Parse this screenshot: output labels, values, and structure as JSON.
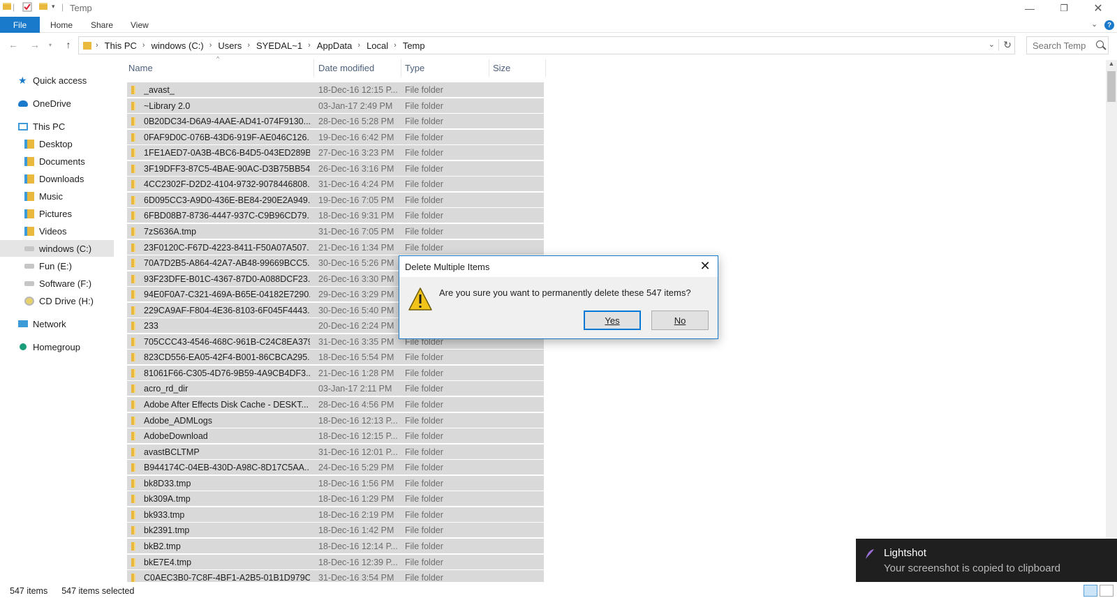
{
  "window": {
    "title": "Temp"
  },
  "ribbon": {
    "file_label": "File",
    "tabs": [
      {
        "label": "Home"
      },
      {
        "label": "Share"
      },
      {
        "label": "View"
      }
    ],
    "help_label": "?"
  },
  "address": {
    "crumbs": [
      "This PC",
      "windows (C:)",
      "Users",
      "SYEDAL~1",
      "AppData",
      "Local",
      "Temp"
    ]
  },
  "search": {
    "placeholder": "Search Temp"
  },
  "sidebar": {
    "items": [
      {
        "label": "Quick access",
        "icon": "star-icon"
      },
      {
        "label": "OneDrive",
        "icon": "cloud-icon"
      },
      {
        "label": "This PC",
        "icon": "computer-icon"
      },
      {
        "label": "Desktop",
        "icon": "desktop-folder-icon"
      },
      {
        "label": "Documents",
        "icon": "documents-folder-icon"
      },
      {
        "label": "Downloads",
        "icon": "downloads-folder-icon"
      },
      {
        "label": "Music",
        "icon": "music-folder-icon"
      },
      {
        "label": "Pictures",
        "icon": "pictures-folder-icon"
      },
      {
        "label": "Videos",
        "icon": "videos-folder-icon"
      },
      {
        "label": "windows (C:)",
        "icon": "windows-drive-icon",
        "selected": true
      },
      {
        "label": "Fun (E:)",
        "icon": "drive-icon"
      },
      {
        "label": "Software (F:)",
        "icon": "drive-icon"
      },
      {
        "label": "CD Drive (H:)",
        "icon": "cd-drive-icon"
      },
      {
        "label": "Network",
        "icon": "network-icon"
      },
      {
        "label": "Homegroup",
        "icon": "homegroup-icon"
      }
    ]
  },
  "columns": {
    "name": "Name",
    "date": "Date modified",
    "type": "Type",
    "size": "Size"
  },
  "files": [
    {
      "name": "_avast_",
      "date": "18-Dec-16 12:15 P...",
      "type": "File folder"
    },
    {
      "name": "~Library 2.0",
      "date": "03-Jan-17 2:49 PM",
      "type": "File folder"
    },
    {
      "name": "0B20DC34-D6A9-4AAE-AD41-074F9130...",
      "date": "28-Dec-16 5:28 PM",
      "type": "File folder"
    },
    {
      "name": "0FAF9D0C-076B-43D6-919F-AE046C126...",
      "date": "19-Dec-16 6:42 PM",
      "type": "File folder"
    },
    {
      "name": "1FE1AED7-0A3B-4BC6-B4D5-043ED289B...",
      "date": "27-Dec-16 3:23 PM",
      "type": "File folder"
    },
    {
      "name": "3F19DFF3-87C5-4BAE-90AC-D3B75BB54...",
      "date": "26-Dec-16 3:16 PM",
      "type": "File folder"
    },
    {
      "name": "4CC2302F-D2D2-4104-9732-9078446808...",
      "date": "31-Dec-16 4:24 PM",
      "type": "File folder"
    },
    {
      "name": "6D095CC3-A9D0-436E-BE84-290E2A949...",
      "date": "19-Dec-16 7:05 PM",
      "type": "File folder"
    },
    {
      "name": "6FBD08B7-8736-4447-937C-C9B96CD79...",
      "date": "18-Dec-16 9:31 PM",
      "type": "File folder"
    },
    {
      "name": "7zS636A.tmp",
      "date": "31-Dec-16 7:05 PM",
      "type": "File folder"
    },
    {
      "name": "23F0120C-F67D-4223-8411-F50A07A507...",
      "date": "21-Dec-16 1:34 PM",
      "type": "File folder"
    },
    {
      "name": "70A7D2B5-A864-42A7-AB48-99669BCC5...",
      "date": "30-Dec-16 5:26 PM",
      "type": "File folder"
    },
    {
      "name": "93F23DFE-B01C-4367-87D0-A088DCF23...",
      "date": "26-Dec-16 3:30 PM",
      "type": "File folder"
    },
    {
      "name": "94E0F0A7-C321-469A-B65E-04182E7290...",
      "date": "29-Dec-16 3:29 PM",
      "type": "File folder"
    },
    {
      "name": "229CA9AF-F804-4E36-8103-6F045F4443...",
      "date": "30-Dec-16 5:40 PM",
      "type": "File folder"
    },
    {
      "name": "233",
      "date": "20-Dec-16 2:24 PM",
      "type": "File folder"
    },
    {
      "name": "705CCC43-4546-468C-961B-C24C8EA379...",
      "date": "31-Dec-16 3:35 PM",
      "type": "File folder"
    },
    {
      "name": "823CD556-EA05-42F4-B001-86CBCA295...",
      "date": "18-Dec-16 5:54 PM",
      "type": "File folder"
    },
    {
      "name": "81061F66-C305-4D76-9B59-4A9CB4DF3...",
      "date": "21-Dec-16 1:28 PM",
      "type": "File folder"
    },
    {
      "name": "acro_rd_dir",
      "date": "03-Jan-17 2:11 PM",
      "type": "File folder"
    },
    {
      "name": "Adobe After Effects Disk Cache - DESKT...",
      "date": "28-Dec-16 4:56 PM",
      "type": "File folder"
    },
    {
      "name": "Adobe_ADMLogs",
      "date": "18-Dec-16 12:13 P...",
      "type": "File folder"
    },
    {
      "name": "AdobeDownload",
      "date": "18-Dec-16 12:15 P...",
      "type": "File folder"
    },
    {
      "name": "avastBCLTMP",
      "date": "31-Dec-16 12:01 P...",
      "type": "File folder"
    },
    {
      "name": "B944174C-04EB-430D-A98C-8D17C5AA...",
      "date": "24-Dec-16 5:29 PM",
      "type": "File folder"
    },
    {
      "name": "bk8D33.tmp",
      "date": "18-Dec-16 1:56 PM",
      "type": "File folder"
    },
    {
      "name": "bk309A.tmp",
      "date": "18-Dec-16 1:29 PM",
      "type": "File folder"
    },
    {
      "name": "bk933.tmp",
      "date": "18-Dec-16 2:19 PM",
      "type": "File folder"
    },
    {
      "name": "bk2391.tmp",
      "date": "18-Dec-16 1:42 PM",
      "type": "File folder"
    },
    {
      "name": "bkB2.tmp",
      "date": "18-Dec-16 12:14 P...",
      "type": "File folder"
    },
    {
      "name": "bkE7E4.tmp",
      "date": "18-Dec-16 12:39 P...",
      "type": "File folder"
    },
    {
      "name": "C0AEC3B0-7C8F-4BF1-A2B5-01B1D979C...",
      "date": "31-Dec-16 3:54 PM",
      "type": "File folder"
    }
  ],
  "status": {
    "count": "547 items",
    "selected": "547 items selected"
  },
  "dialog": {
    "title": "Delete Multiple Items",
    "message": "Are you sure you want to permanently delete these 547 items?",
    "yes_label": "Yes",
    "no_label": "No"
  },
  "toast": {
    "title": "Lightshot",
    "message": "Your screenshot is copied to clipboard"
  },
  "colors": {
    "accent": "#1979ca",
    "folder": "#e8b93c",
    "selection": "#d9d9d9"
  }
}
